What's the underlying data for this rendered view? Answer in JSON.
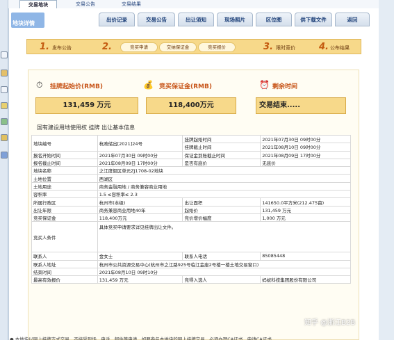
{
  "top_tabs": [
    {
      "label": "交易地块",
      "active": true
    },
    {
      "label": "交易公告",
      "active": false
    },
    {
      "label": "交易结果",
      "active": false
    }
  ],
  "header": {
    "logo_text": "地块详情",
    "nav": [
      "出价记录",
      "交易公告",
      "出让须知",
      "现场照片",
      "区位图",
      "供下载文件",
      "返回"
    ]
  },
  "steps": {
    "s1_num": "1.",
    "s1_label": "发布公告",
    "s2_num": "2.",
    "s2_items": [
      "竞买申请",
      "交纳保证金",
      "竞买报价"
    ],
    "s3_num": "3.",
    "s3_label": "限时竞价",
    "s4_num": "4.",
    "s4_label": "公布结果"
  },
  "summary": {
    "start_price_title": "挂牌起始价(RMB)",
    "start_price_value": "131,459 万元",
    "deposit_title": "竞买保证金(RMB)",
    "deposit_value": "118,400万元",
    "remaining_title": "剩余时间",
    "remaining_value": "交易结束....."
  },
  "section_title": "国有建设用地使用权 挂牌 出让基本信息",
  "info": {
    "parcel_no_label": "地块编号",
    "parcel_no": "杭政储出[2021]24号",
    "listing_start_label": "挂牌起始时间",
    "listing_start": "2021年07月30日 09时00分",
    "listing_end_label": "挂牌截止时间",
    "listing_end": "2021年08月10日 09时00分",
    "apply_start_label": "报名开始时间",
    "apply_start": "2021年07月30日 09时00分",
    "deposit_deadline_label": "保证金到账截止时间",
    "deposit_deadline": "2021年08月09日 17时00分",
    "apply_end_label": "报名截止时间",
    "apply_end": "2021年08月09日 17时00分",
    "reserve_label": "是否有底价",
    "reserve": "无底价",
    "parcel_name_label": "地块名称",
    "parcel_name": "之江度假区单元ZJ1708-02地块",
    "location_label": "土地位置",
    "location": "西湖区",
    "use_label": "土地用途",
    "use": "商务金融用地 / 商务兼容商业用地",
    "far_label": "容积率",
    "far": "1.5 ≤容积率≤ 2.3",
    "district_label": "所属行政区",
    "district": "杭州市(本级)",
    "area_label": "出让面积",
    "area": "141650.0平方米(212.475亩)",
    "term_label": "出让年限",
    "term": "商务兼容商业用地40年",
    "start_price_label": "起始价",
    "start_price": "131,459 万元",
    "deposit_label": "竞买保证金",
    "deposit": "118,400万元",
    "increment_label": "竞价增价幅度",
    "increment": "1,000 万元",
    "conditions_label": "竞买人条件",
    "conditions": "具体竞买申请要求详见挂牌出让文件。",
    "contact_label": "联系人",
    "contact": "金女士",
    "phone_label": "联系人电话",
    "phone": "85085448",
    "address_label": "联系人地址",
    "address": "杭州市公共资源交易中心(杭州市之江路925号临江金座2号楼一楼土地交易窗口)",
    "end_time_label": "结束时间",
    "end_time": "2021年08月10日 09时10分",
    "highest_bid_label": "最高有效报价",
    "highest_bid": "131,459 万元",
    "winner_label": "竞得入选人",
    "winner": "蚂蚁科技集团股份有限公司"
  },
  "bottom_note": "● 本地块以网上挂牌方式交易，不接受现场、电话、邮件等申请，如要参与本地块的网上挂牌交易，必须办理CA证书，申请CA证书",
  "watermark": "知乎 @浙江B2B"
}
